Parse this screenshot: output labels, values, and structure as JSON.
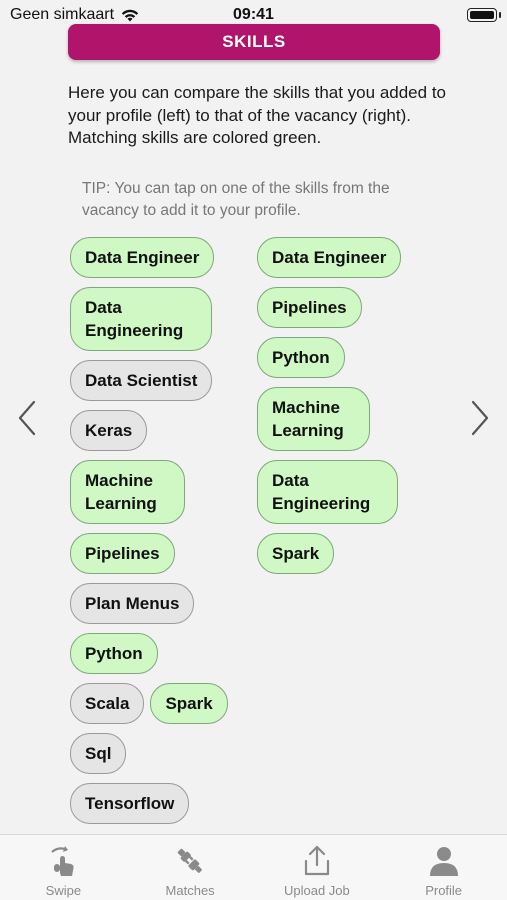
{
  "status_bar": {
    "carrier": "Geen simkaart",
    "time": "09:41"
  },
  "header": {
    "title": "SKILLS",
    "accent_color": "#b0146b"
  },
  "intro_text": "Here you can compare the skills that you added to your profile (left) to that of the vacancy (right). Matching skills are colored green.",
  "tip_text": "TIP: You can tap on one of the skills from the vacancy to add it to your profile.",
  "profile_skills": [
    {
      "label": "Data Engineer",
      "match": true
    },
    {
      "label": "Data Engineering",
      "match": true
    },
    {
      "label": "Data Scientist",
      "match": false
    },
    {
      "label": "Keras",
      "match": false
    },
    {
      "label": "Machine Learning",
      "match": true
    },
    {
      "label": "Pipelines",
      "match": true
    },
    {
      "label": "Plan Menus",
      "match": false
    },
    {
      "label": "Python",
      "match": true
    },
    {
      "label": "Scala",
      "match": false
    },
    {
      "label": "Spark",
      "match": true
    },
    {
      "label": "Sql",
      "match": false
    },
    {
      "label": "Tensorflow",
      "match": false
    }
  ],
  "vacancy_skills": [
    {
      "label": "Data Engineer",
      "match": true
    },
    {
      "label": "Pipelines",
      "match": true
    },
    {
      "label": "Python",
      "match": true
    },
    {
      "label": "Machine Learning",
      "match": true
    },
    {
      "label": "Data Engineering",
      "match": true
    },
    {
      "label": "Spark",
      "match": true
    }
  ],
  "colors": {
    "match_bg": "#cff8c4",
    "nonmatch_bg": "#e5e5e5"
  },
  "tabbar": {
    "tabs": [
      {
        "label": "Swipe",
        "icon": "swipe-icon"
      },
      {
        "label": "Matches",
        "icon": "plug-icon"
      },
      {
        "label": "Upload Job",
        "icon": "upload-icon"
      },
      {
        "label": "Profile",
        "icon": "person-icon"
      }
    ]
  }
}
